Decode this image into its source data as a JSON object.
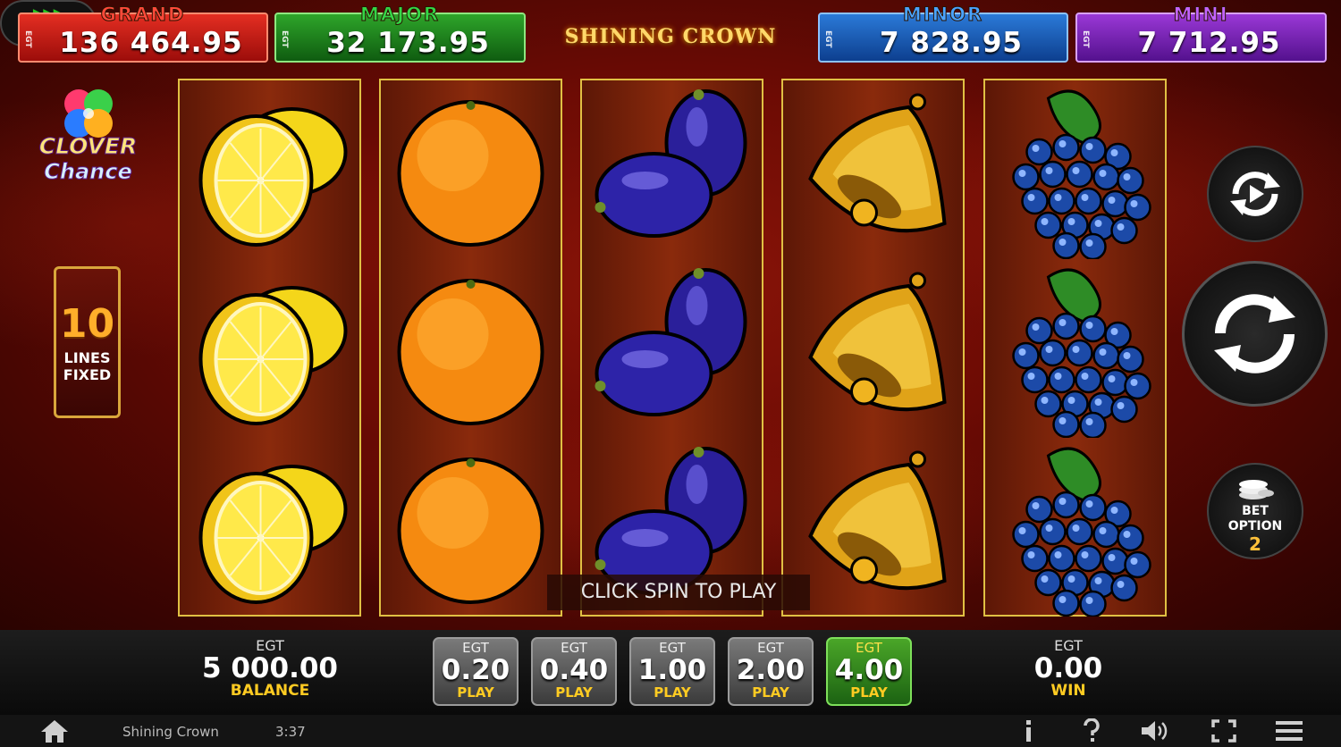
{
  "jackpots": {
    "grand": {
      "label": "GRAND",
      "value": "136 464.95",
      "tag": "EGT"
    },
    "major": {
      "label": "MAJOR",
      "value": "32 173.95",
      "tag": "EGT"
    },
    "minor": {
      "label": "MINOR",
      "value": "7 828.95",
      "tag": "EGT"
    },
    "mini": {
      "label": "MINI",
      "value": "7 712.95",
      "tag": "EGT"
    }
  },
  "game_title": "SHINING CROWN",
  "logo": {
    "line1": "CLOVER",
    "line2": "Chance"
  },
  "lines": {
    "number": "10",
    "line1": "LINES",
    "line2": "FIXED"
  },
  "reels": [
    [
      "lemon",
      "lemon",
      "lemon"
    ],
    [
      "orange",
      "orange",
      "orange"
    ],
    [
      "plum",
      "plum",
      "plum"
    ],
    [
      "bell",
      "bell",
      "bell"
    ],
    [
      "grapes",
      "grapes",
      "grapes"
    ]
  ],
  "hint": "CLICK SPIN TO PLAY",
  "controls": {
    "speed_label": "SPEED",
    "bet_option_label_1": "BET",
    "bet_option_label_2": "OPTION",
    "bet_option_value": "2"
  },
  "balance": {
    "tag": "EGT",
    "value": "5 000.00",
    "label": "BALANCE"
  },
  "win": {
    "tag": "EGT",
    "value": "0.00",
    "label": "WIN"
  },
  "bets": [
    {
      "tag": "EGT",
      "amount": "0.20",
      "label": "PLAY",
      "active": false
    },
    {
      "tag": "EGT",
      "amount": "0.40",
      "label": "PLAY",
      "active": false
    },
    {
      "tag": "EGT",
      "amount": "1.00",
      "label": "PLAY",
      "active": false
    },
    {
      "tag": "EGT",
      "amount": "2.00",
      "label": "PLAY",
      "active": false
    },
    {
      "tag": "EGT",
      "amount": "4.00",
      "label": "PLAY",
      "active": true
    }
  ],
  "footer": {
    "title": "Shining Crown",
    "time": "3:37",
    "icons": [
      "home-icon",
      "info-icon",
      "help-icon",
      "sound-icon",
      "fullscreen-icon",
      "menu-icon"
    ]
  },
  "colors": {
    "grand": "#d02418",
    "major": "#1f8a1c",
    "minor": "#1e62c0",
    "mini": "#7b22b6",
    "active_bet": "#3a9a22",
    "accent_gold": "#ffcb22"
  }
}
